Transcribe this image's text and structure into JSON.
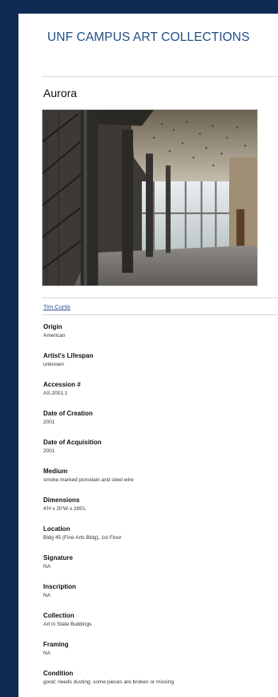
{
  "header": {
    "site_title": "UNF CAMPUS ART COLLECTIONS"
  },
  "artwork": {
    "title": "Aurora",
    "artist": "Tim Curtis"
  },
  "details": [
    {
      "label": "Origin",
      "value": "American"
    },
    {
      "label": "Artist's Lifespan",
      "value": "unknown"
    },
    {
      "label": "Accession #",
      "value": "AS.2001.1"
    },
    {
      "label": "Date of Creation",
      "value": "2001"
    },
    {
      "label": "Date of Acquisition",
      "value": "2001"
    },
    {
      "label": "Medium",
      "value": "smoke marked porcelain and steel wire"
    },
    {
      "label": "Dimensions",
      "value": "4'H x 20'W x 285'L"
    },
    {
      "label": "Location",
      "value": "Bldg 45 (Fine Arts Bldg), 1st Floor"
    },
    {
      "label": "Signature",
      "value": "NA"
    },
    {
      "label": "Inscription",
      "value": "NA"
    },
    {
      "label": "Collection",
      "value": "Art in State Buildings"
    },
    {
      "label": "Framing",
      "value": "NA"
    },
    {
      "label": "Condition",
      "value": "good; needs dusting; some pieces are broken or missing"
    }
  ],
  "colors": {
    "background": "#0f2a55",
    "title": "#1f4f86",
    "link": "#2a4f9b"
  }
}
